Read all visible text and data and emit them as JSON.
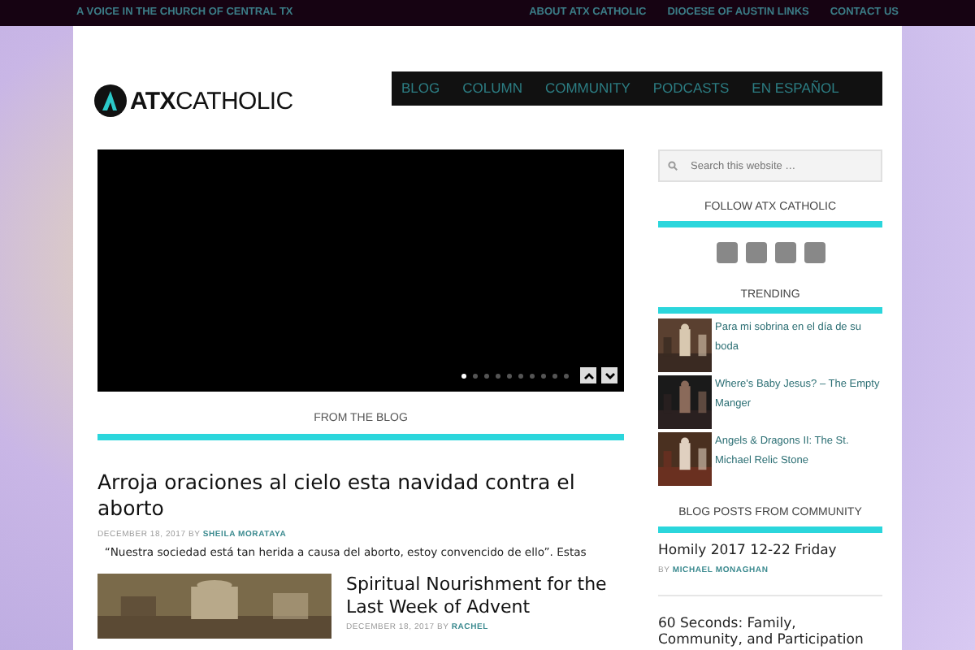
{
  "top_bar": {
    "tagline": "A VOICE IN THE CHURCH OF CENTRAL TX",
    "links": [
      "ABOUT ATX CATHOLIC",
      "DIOCESE OF AUSTIN LINKS",
      "CONTACT US"
    ]
  },
  "header": {
    "logo": {
      "strong": "ATX",
      "light": "CATHOLIC"
    },
    "nav": [
      "BLOG",
      "COLUMN",
      "COMMUNITY",
      "PODCASTS",
      "EN ESPAÑOL"
    ]
  },
  "slider": {
    "dots": [
      {
        "selected": true
      },
      {
        "selected": false
      },
      {
        "selected": false
      },
      {
        "selected": false
      },
      {
        "selected": false
      },
      {
        "selected": false
      },
      {
        "selected": false
      },
      {
        "selected": false
      },
      {
        "selected": false
      },
      {
        "selected": false
      }
    ]
  },
  "main": {
    "section_title": "FROM THE BLOG",
    "posts": [
      {
        "title": "Arroja oraciones al cielo esta navidad contra el aborto",
        "date": "DECEMBER 18, 2017",
        "by": "BY",
        "author": "SHEILA MORATAYA",
        "excerpt": "“Nuestra sociedad está tan herida a causa del aborto, estoy convencido de ello”. Estas"
      },
      {
        "title": "Spiritual Nourishment for the Last Week of Advent",
        "date": "DECEMBER 18, 2017",
        "by": "BY",
        "author": "RACHEL",
        "kind": "picture"
      }
    ]
  },
  "sidebar": {
    "search": {
      "placeholder": "Search this website …"
    },
    "follow": {
      "title": "FOLLOW ATX CATHOLIC",
      "icons": [
        {
          "kind": "social"
        },
        {
          "kind": "social"
        },
        {
          "kind": "social"
        },
        {
          "kind": "social"
        }
      ]
    },
    "trending": {
      "title": "TRENDING",
      "items": [
        {
          "title": "Para mi sobrina en el día de su boda"
        },
        {
          "title": "Where's Baby Jesus? – The Empty Manger"
        },
        {
          "title": "Angels & Dragons II: The St. Michael Relic Stone"
        }
      ]
    },
    "community": {
      "title": "BLOG POSTS FROM COMMUNITY",
      "posts": [
        {
          "title": "Homily 2017 12-22 Friday",
          "by": "BY",
          "author": "MICHAEL MONAGHAN"
        },
        {
          "title": "60 Seconds: Family, Community, and Participation"
        }
      ]
    }
  }
}
